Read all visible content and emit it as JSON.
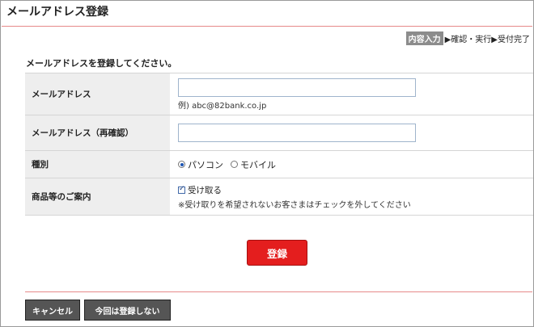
{
  "page": {
    "title": "メールアドレス登録"
  },
  "steps": {
    "active": "内容入力",
    "rest": "▶確認・実行▶受付完了"
  },
  "instruction": "メールアドレスを登録してください。",
  "form": {
    "email": {
      "label": "メールアドレス",
      "value": "",
      "example": "例) abc@82bank.co.jp"
    },
    "email_confirm": {
      "label": "メールアドレス（再確認）",
      "value": ""
    },
    "type": {
      "label": "種別",
      "options": [
        "パソコン",
        "モバイル"
      ],
      "selected": "パソコン"
    },
    "info": {
      "label": "商品等のご案内",
      "checkbox_label": "受け取る",
      "checked": true,
      "note": "※受け取りを希望されないお客さまはチェックを外してください"
    }
  },
  "buttons": {
    "submit": "登録",
    "cancel": "キャンセル",
    "skip": "今回は登録しない"
  },
  "colors": {
    "submit": "#e41e1e",
    "secondary": "#555555",
    "rule": "#e68a8a",
    "label_bg": "#eeeeee"
  }
}
